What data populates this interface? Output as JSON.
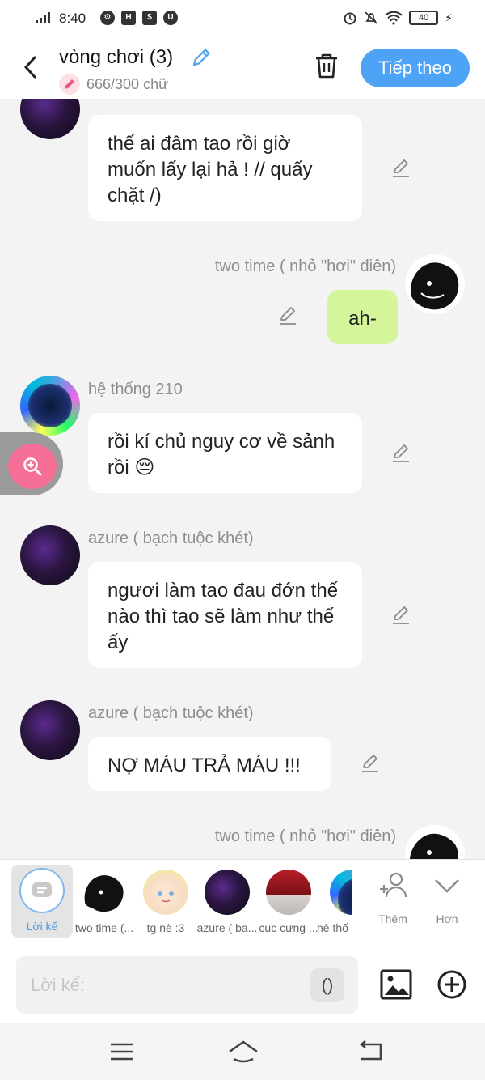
{
  "status_bar": {
    "time": "8:40",
    "battery": "40"
  },
  "header": {
    "title": "vòng chơi (3)",
    "char_count": "666/300 chữ",
    "next_label": "Tiếp theo"
  },
  "messages": [
    {
      "sender": "",
      "text": "thế ai đâm tao rồi giờ muốn lấy lại hả ! // quấy chặt /)",
      "side": "left"
    },
    {
      "sender": "two time ( nhỏ \"hơi\" điên)",
      "text": "ah-",
      "side": "right"
    },
    {
      "sender": "hệ thống 210",
      "text": "rồi kí chủ nguy cơ về sảnh rồi 😔",
      "side": "left"
    },
    {
      "sender": "azure ( bạch tuộc khét)",
      "text": "ngươi làm tao đau đớn thế nào thì tao sẽ làm như thế ấy",
      "side": "left"
    },
    {
      "sender": "azure ( bạch tuộc khét)",
      "text": "NỢ MÁU TRẢ MÁU !!!",
      "side": "left"
    },
    {
      "sender": "two time ( nhỏ \"hơi\" điên)",
      "text": "",
      "side": "right"
    }
  ],
  "characters": [
    {
      "label": "Lời kể"
    },
    {
      "label": "two time (..."
    },
    {
      "label": "tg nè :3"
    },
    {
      "label": "azure ( bạ..."
    },
    {
      "label": "cục cưng ..."
    },
    {
      "label": "hệ thố"
    }
  ],
  "controls": {
    "add_label": "Thêm",
    "more_label": "Hơn"
  },
  "composer": {
    "placeholder": "Lời kể:",
    "paren_label": "()"
  },
  "colors": {
    "accent": "#4da3f5",
    "bubble_self": "#d4f59a",
    "zoom": "#f56f97"
  }
}
